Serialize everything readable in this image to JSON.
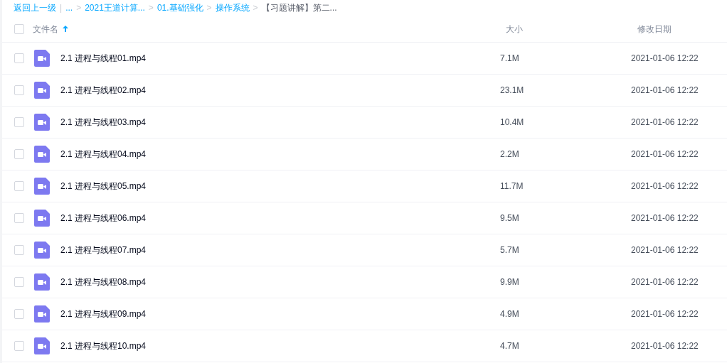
{
  "breadcrumb": {
    "back": "返回上一级",
    "divider": "|",
    "items": [
      {
        "label": "...",
        "link": true
      },
      {
        "label": "2021王道计算...",
        "link": true
      },
      {
        "label": "01.基础强化",
        "link": true
      },
      {
        "label": "操作系统",
        "link": true
      },
      {
        "label": "【习题讲解】第二...",
        "link": false
      }
    ],
    "separator": ">"
  },
  "table": {
    "select_all": {
      "checked": false
    },
    "columns": [
      {
        "label": "文件名",
        "sort_ascending": true
      },
      {
        "label": "大小"
      },
      {
        "label": "修改日期"
      }
    ],
    "rows": [
      {
        "name": "2.1 进程与线程01.mp4",
        "size": "7.1M",
        "date": "2021-01-06 12:22",
        "checked": false
      },
      {
        "name": "2.1 进程与线程02.mp4",
        "size": "23.1M",
        "date": "2021-01-06 12:22",
        "checked": false
      },
      {
        "name": "2.1 进程与线程03.mp4",
        "size": "10.4M",
        "date": "2021-01-06 12:22",
        "checked": false
      },
      {
        "name": "2.1 进程与线程04.mp4",
        "size": "2.2M",
        "date": "2021-01-06 12:22",
        "checked": false
      },
      {
        "name": "2.1 进程与线程05.mp4",
        "size": "11.7M",
        "date": "2021-01-06 12:22",
        "checked": false
      },
      {
        "name": "2.1 进程与线程06.mp4",
        "size": "9.5M",
        "date": "2021-01-06 12:22",
        "checked": false
      },
      {
        "name": "2.1 进程与线程07.mp4",
        "size": "5.7M",
        "date": "2021-01-06 12:22",
        "checked": false
      },
      {
        "name": "2.1 进程与线程08.mp4",
        "size": "9.9M",
        "date": "2021-01-06 12:22",
        "checked": false
      },
      {
        "name": "2.1 进程与线程09.mp4",
        "size": "4.9M",
        "date": "2021-01-06 12:22",
        "checked": false
      },
      {
        "name": "2.1 进程与线程10.mp4",
        "size": "4.7M",
        "date": "2021-01-06 12:22",
        "checked": false
      }
    ]
  }
}
